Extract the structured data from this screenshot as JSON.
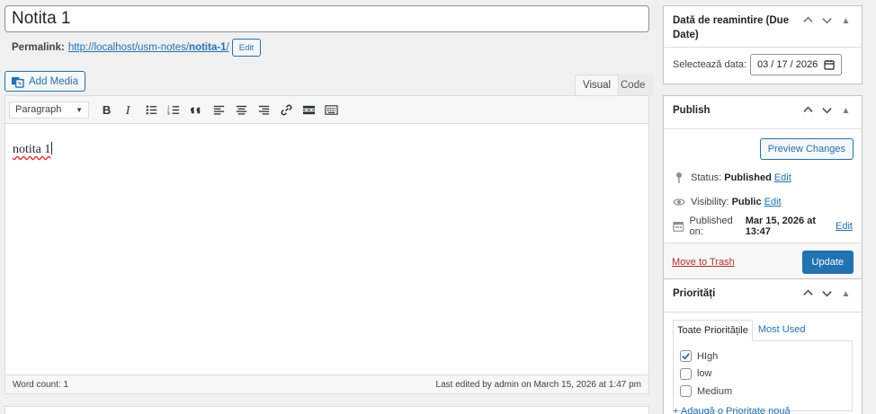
{
  "post": {
    "title": "Notita 1",
    "permalink_label": "Permalink:",
    "permalink_base": "http://localhost/usm-notes/",
    "permalink_slug": "notita-1",
    "permalink_trail": "/",
    "permalink_edit": "Edit"
  },
  "media": {
    "add_label": "Add Media"
  },
  "tabs": {
    "visual": "Visual",
    "code": "Code"
  },
  "toolbar": {
    "format_value": "Paragraph",
    "icons": [
      "bold-icon",
      "italic-icon",
      "bullet-list-icon",
      "numbered-list-icon",
      "blockquote-icon",
      "align-left-icon",
      "align-center-icon",
      "align-right-icon",
      "link-icon",
      "read-more-icon",
      "toolbar-toggle-icon"
    ]
  },
  "editor": {
    "content": "notita 1",
    "word_count": "Word count: 1",
    "last_edited": "Last edited by admin on March 15, 2026 at 1:47 pm"
  },
  "due_date": {
    "title": "Dată de reamintire (Due Date)",
    "label": "Selectează data:",
    "value": "03 / 17 / 2026"
  },
  "publish": {
    "title": "Publish",
    "preview": "Preview Changes",
    "status_label": "Status:",
    "status_value": "Published",
    "visibility_label": "Visibility:",
    "visibility_value": "Public",
    "published_label": "Published on:",
    "published_value": "Mar 15, 2026 at 13:47",
    "edit": "Edit",
    "trash": "Move to Trash",
    "update": "Update"
  },
  "priorities": {
    "title": "Priorități",
    "tab_all": "Toate Prioritățile",
    "tab_used": "Most Used",
    "items": [
      {
        "label": "HIgh",
        "checked": true
      },
      {
        "label": "low",
        "checked": false
      },
      {
        "label": "Medium",
        "checked": false
      }
    ],
    "add_new": "+ Adaugă o Prioritate nouă"
  },
  "colors": {
    "accent": "#2271b1",
    "trash": "#b32d2e",
    "background": "#f0f0f1"
  }
}
